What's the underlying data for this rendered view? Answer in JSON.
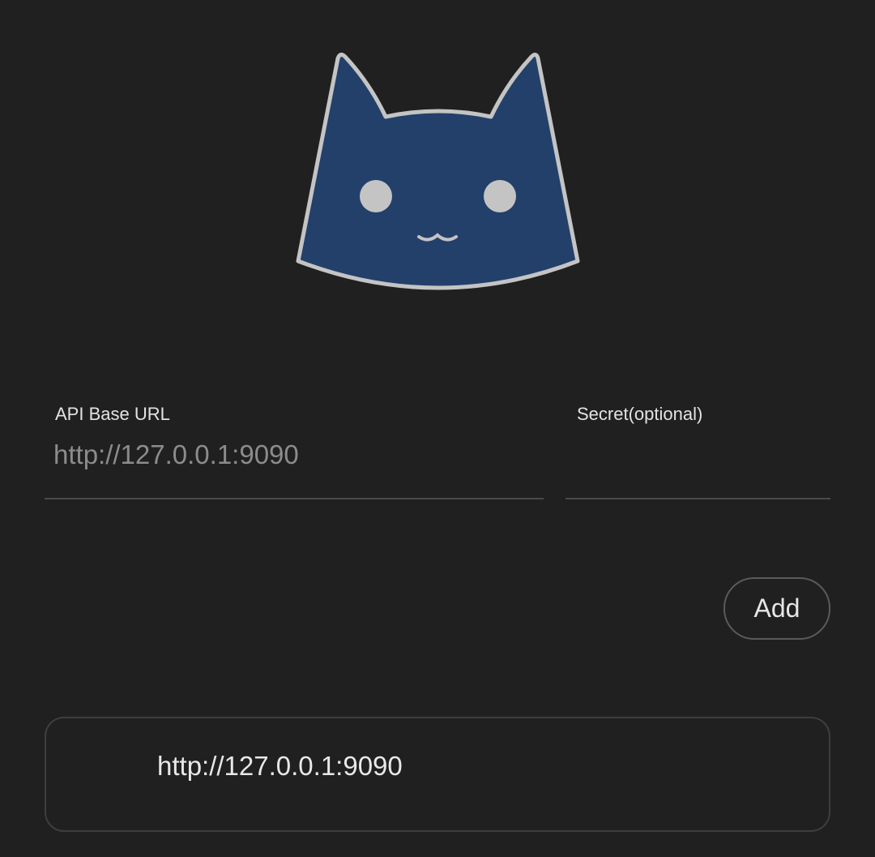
{
  "logo": {
    "icon": "cat-face-icon",
    "fill_color": "#23406a",
    "outline_color": "#c4c4c4"
  },
  "form": {
    "api_base_url": {
      "label": "API Base URL",
      "value": "",
      "placeholder": "http://127.0.0.1:9090"
    },
    "secret": {
      "label": "Secret(optional)",
      "value": "",
      "placeholder": ""
    },
    "add_label": "Add"
  },
  "servers": [
    {
      "url": "http://127.0.0.1:9090"
    }
  ],
  "colors": {
    "background": "#202020",
    "text": "#e6e6e6",
    "placeholder": "#8c8c8c",
    "border": "#4a4a4a"
  }
}
